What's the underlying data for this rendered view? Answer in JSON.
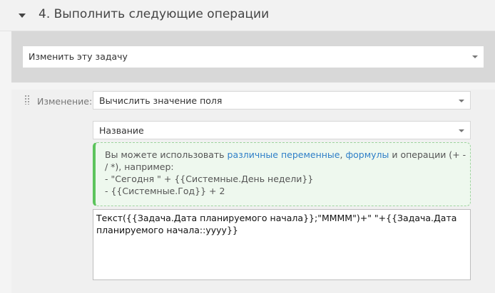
{
  "section": {
    "title": "4. Выполнить следующие операции"
  },
  "action": {
    "selected": "Изменить эту задачу"
  },
  "change": {
    "label": "Изменение:",
    "operation": "Вычислить значение поля",
    "field": "Название"
  },
  "hint": {
    "part1": "Вы можете использовать ",
    "link_variables": "различные переменные",
    "part2": ", ",
    "link_formulas": "формулы",
    "part3": " и операции (+ -",
    "line2": "/ *), например:",
    "line3": "- \"Сегодня \" + {{Системные.День недели}}",
    "line4": "- {{Системные.Год}} + 2"
  },
  "formula": {
    "value": "Текст({{Задача.Дата планируемого начала}};\"ММММ\")+\" \"+{{Задача.Дата планируемого начала::yyyy}}"
  }
}
